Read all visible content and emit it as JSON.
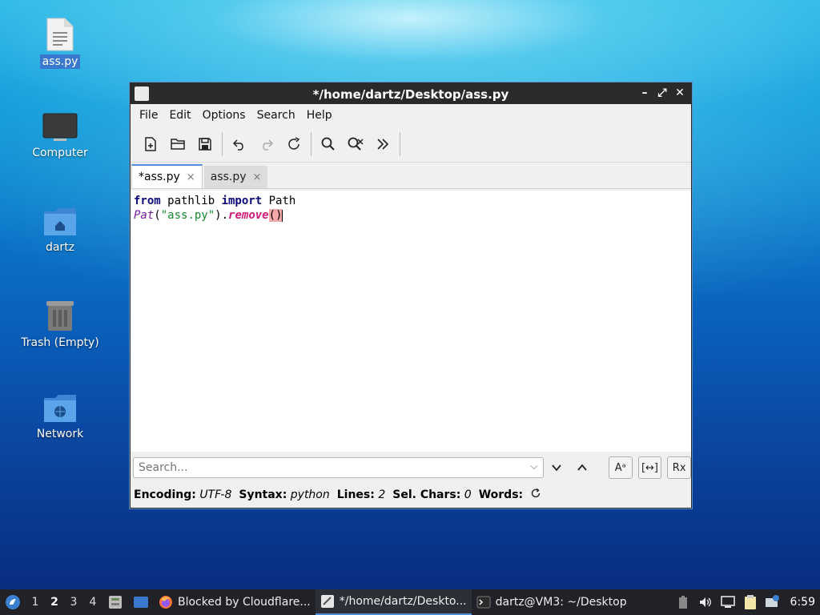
{
  "desktop": {
    "icons": [
      {
        "label": "ass.py"
      },
      {
        "label": "Computer"
      },
      {
        "label": "dartz"
      },
      {
        "label": "Trash (Empty)"
      },
      {
        "label": "Network"
      }
    ]
  },
  "window": {
    "title": "*/home/dartz/Desktop/ass.py",
    "menu": [
      "File",
      "Edit",
      "Options",
      "Search",
      "Help"
    ],
    "tabs": [
      {
        "label": "*ass.py",
        "close": "×"
      },
      {
        "label": "ass.py",
        "close": "×"
      }
    ],
    "code": {
      "line1": {
        "kw1": "from",
        "t1": " pathlib ",
        "kw2": "import",
        "t2": " Path"
      },
      "line2": {
        "cls": "Pat",
        "p1": "(",
        "str": "\"ass.py\"",
        "p2": ").",
        "method": "remove",
        "parens": "()"
      }
    },
    "search": {
      "placeholder": "Search..."
    },
    "search_options": {
      "case": "Aᵃ",
      "word": "[↔]",
      "regex": "Rx"
    },
    "status": {
      "encoding_label": "Encoding:",
      "encoding_value": "UTF-8",
      "syntax_label": "Syntax:",
      "syntax_value": "python",
      "lines_label": "Lines:",
      "lines_value": "2",
      "selchars_label": "Sel. Chars:",
      "selchars_value": "0",
      "words_label": "Words:"
    }
  },
  "taskbar": {
    "workspaces": [
      "1",
      "2",
      "3",
      "4"
    ],
    "active_workspace": "2",
    "tasks": [
      {
        "label": "Blocked by Cloudflare..."
      },
      {
        "label": "*/home/dartz/Deskto..."
      },
      {
        "label": "dartz@VM3: ~/Desktop"
      }
    ],
    "clock": "6:59"
  }
}
